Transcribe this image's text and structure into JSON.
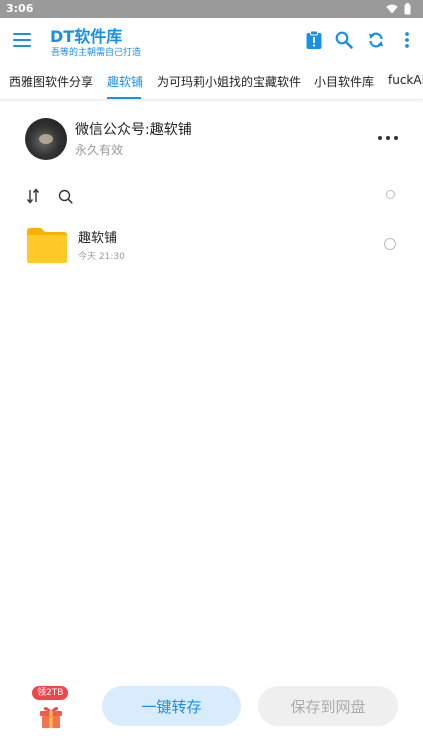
{
  "status_bar": {
    "time": "3:06"
  },
  "app_bar": {
    "title": "DT软件库",
    "subtitle": "吾等的主朝需自己打造",
    "accent_color": "#1890e8"
  },
  "tabs": [
    {
      "label": "西雅图软件分享",
      "active": false
    },
    {
      "label": "趣软铺",
      "active": true
    },
    {
      "label": "为可玛莉小姐找的宝藏软件",
      "active": false
    },
    {
      "label": "小目软件库",
      "active": false
    },
    {
      "label": "fuckAPP",
      "active": false
    }
  ],
  "share": {
    "title": "微信公众号:趣软铺",
    "expiry": "永久有效"
  },
  "files": [
    {
      "name": "趣软铺",
      "time": "今天 21:30",
      "icon": "folder-icon"
    }
  ],
  "bottom": {
    "gift_badge": "领2TB",
    "quick_save_label": "一键转存",
    "save_to_disk_label": "保存到网盘"
  }
}
